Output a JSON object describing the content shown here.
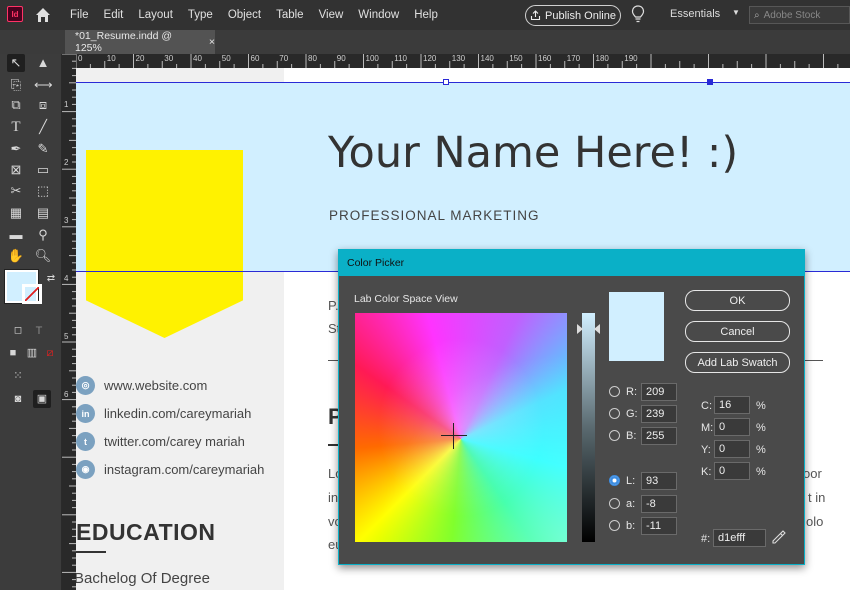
{
  "app": {
    "logo": "Id",
    "menus": [
      "File",
      "Edit",
      "Layout",
      "Type",
      "Object",
      "Table",
      "View",
      "Window",
      "Help"
    ],
    "publish_label": "Publish Online",
    "workspace": "Essentials",
    "stock_placeholder": "Adobe Stock"
  },
  "document": {
    "tab_title": "*01_Resume.indd @ 125%",
    "tab_close": "×"
  },
  "rulers": {
    "top_ticks": [
      "0",
      "10",
      "20",
      "30",
      "40",
      "50",
      "60",
      "70",
      "80",
      "90",
      "100",
      "110",
      "120",
      "130",
      "140",
      "150",
      "160",
      "170",
      "180",
      "190"
    ],
    "left_ticks": [
      "1",
      "2",
      "3",
      "4",
      "5",
      "6"
    ]
  },
  "resume": {
    "name": "Your Name Here! :)",
    "subtitle": "PROFESSIONAL MARKETING",
    "social": [
      {
        "icon": "dribbble-icon",
        "glyph": "◎",
        "text": "www.website.com"
      },
      {
        "icon": "linkedin-icon",
        "glyph": "in",
        "text": "linkedin.com/careymariah"
      },
      {
        "icon": "twitter-icon",
        "glyph": "t",
        "text": "twitter.com/carey mariah"
      },
      {
        "icon": "instagram-icon",
        "glyph": "◉",
        "text": "instagram.com/careymariah"
      }
    ],
    "education_title": "EDUCATION",
    "degree": "Bachelog Of Degree",
    "fragments": {
      "p1": "P.",
      "p2": "St",
      "heading_p": "P",
      "lo": "Lo",
      "in": "in",
      "vo": "vo",
      "eu": "eu",
      "or": "oor",
      "tin": "t in",
      "olo": "olo"
    }
  },
  "color_picker": {
    "title": "Color Picker",
    "view_label": "Lab Color Space View",
    "preview_color": "#d1efff",
    "buttons": {
      "ok": "OK",
      "cancel": "Cancel",
      "add_swatch": "Add Lab Swatch"
    },
    "rgb": [
      {
        "label": "R:",
        "value": "209"
      },
      {
        "label": "G:",
        "value": "239"
      },
      {
        "label": "B:",
        "value": "255"
      }
    ],
    "lab": [
      {
        "label": "L:",
        "value": "93"
      },
      {
        "label": "a:",
        "value": "-8"
      },
      {
        "label": "b:",
        "value": "-11"
      }
    ],
    "cmyk": [
      {
        "label": "C:",
        "value": "16",
        "unit": "%"
      },
      {
        "label": "M:",
        "value": "0",
        "unit": "%"
      },
      {
        "label": "Y:",
        "value": "0",
        "unit": "%"
      },
      {
        "label": "K:",
        "value": "0",
        "unit": "%"
      }
    ],
    "hex_label": "#:",
    "hex_value": "d1efff",
    "selected_mode": "L"
  }
}
